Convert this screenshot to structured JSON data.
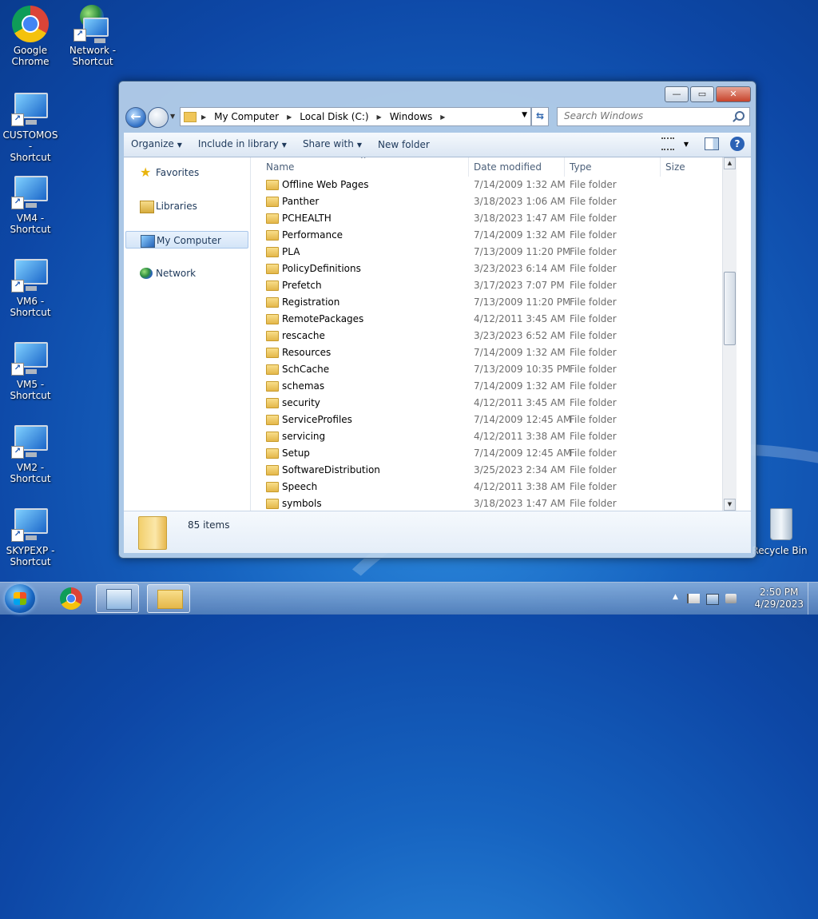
{
  "desktop": {
    "icons": [
      {
        "line1": "Google",
        "line2": "Chrome"
      },
      {
        "line1": "Network -",
        "line2": "Shortcut"
      },
      {
        "line1": "CUSTOMOS -",
        "line2": "Shortcut"
      },
      {
        "line1": "VM4 -",
        "line2": "Shortcut"
      },
      {
        "line1": "VM6 -",
        "line2": "Shortcut"
      },
      {
        "line1": "VM5 -",
        "line2": "Shortcut"
      },
      {
        "line1": "VM2 -",
        "line2": "Shortcut"
      },
      {
        "line1": "SKYPEXP -",
        "line2": "Shortcut"
      },
      {
        "line1": "Recycle Bin",
        "line2": ""
      }
    ],
    "shortcut_arrow": "↗"
  },
  "window": {
    "controls": {
      "minimize": "—",
      "maximize": "▭",
      "close": "✕"
    },
    "nav": {
      "back": "←",
      "history": "▼"
    },
    "breadcrumb": [
      "My Computer",
      "Local Disk (C:)",
      "Windows"
    ],
    "breadcrumb_sep": "▶",
    "address_dropdown": "▼",
    "refresh": "⇆",
    "search_placeholder": "Search Windows",
    "toolbar": {
      "organize": "Organize",
      "include_in_library": "Include in library",
      "share_with": "Share with",
      "new_folder": "New folder",
      "caret": "▼",
      "help": "?"
    },
    "navpane": {
      "favorites": "Favorites",
      "libraries": "Libraries",
      "my_computer": "My Computer",
      "network": "Network",
      "star": "★"
    },
    "columns": {
      "name": "Name",
      "date": "Date modified",
      "type": "Type",
      "size": "Size",
      "sort_indicator": "^"
    },
    "files": [
      {
        "name": "Offline Web Pages",
        "date": "7/14/2009 1:32 AM",
        "type": "File folder"
      },
      {
        "name": "Panther",
        "date": "3/18/2023 1:06 AM",
        "type": "File folder"
      },
      {
        "name": "PCHEALTH",
        "date": "3/18/2023 1:47 AM",
        "type": "File folder"
      },
      {
        "name": "Performance",
        "date": "7/14/2009 1:32 AM",
        "type": "File folder"
      },
      {
        "name": "PLA",
        "date": "7/13/2009 11:20 PM",
        "type": "File folder"
      },
      {
        "name": "PolicyDefinitions",
        "date": "3/23/2023 6:14 AM",
        "type": "File folder"
      },
      {
        "name": "Prefetch",
        "date": "3/17/2023 7:07 PM",
        "type": "File folder"
      },
      {
        "name": "Registration",
        "date": "7/13/2009 11:20 PM",
        "type": "File folder"
      },
      {
        "name": "RemotePackages",
        "date": "4/12/2011 3:45 AM",
        "type": "File folder"
      },
      {
        "name": "rescache",
        "date": "3/23/2023 6:52 AM",
        "type": "File folder"
      },
      {
        "name": "Resources",
        "date": "7/14/2009 1:32 AM",
        "type": "File folder"
      },
      {
        "name": "SchCache",
        "date": "7/13/2009 10:35 PM",
        "type": "File folder"
      },
      {
        "name": "schemas",
        "date": "7/14/2009 1:32 AM",
        "type": "File folder"
      },
      {
        "name": "security",
        "date": "4/12/2011 3:45 AM",
        "type": "File folder"
      },
      {
        "name": "ServiceProfiles",
        "date": "7/14/2009 12:45 AM",
        "type": "File folder"
      },
      {
        "name": "servicing",
        "date": "4/12/2011 3:38 AM",
        "type": "File folder"
      },
      {
        "name": "Setup",
        "date": "7/14/2009 12:45 AM",
        "type": "File folder"
      },
      {
        "name": "SoftwareDistribution",
        "date": "3/25/2023 2:34 AM",
        "type": "File folder"
      },
      {
        "name": "Speech",
        "date": "4/12/2011 3:38 AM",
        "type": "File folder"
      },
      {
        "name": "symbols",
        "date": "3/18/2023 1:47 AM",
        "type": "File folder"
      }
    ],
    "scroll_up": "▲",
    "scroll_down": "▼",
    "item_count": "85 items"
  },
  "taskbar": {
    "clock_time": "2:50 PM",
    "clock_date": "4/29/2023",
    "tray_arrow": "▲"
  }
}
